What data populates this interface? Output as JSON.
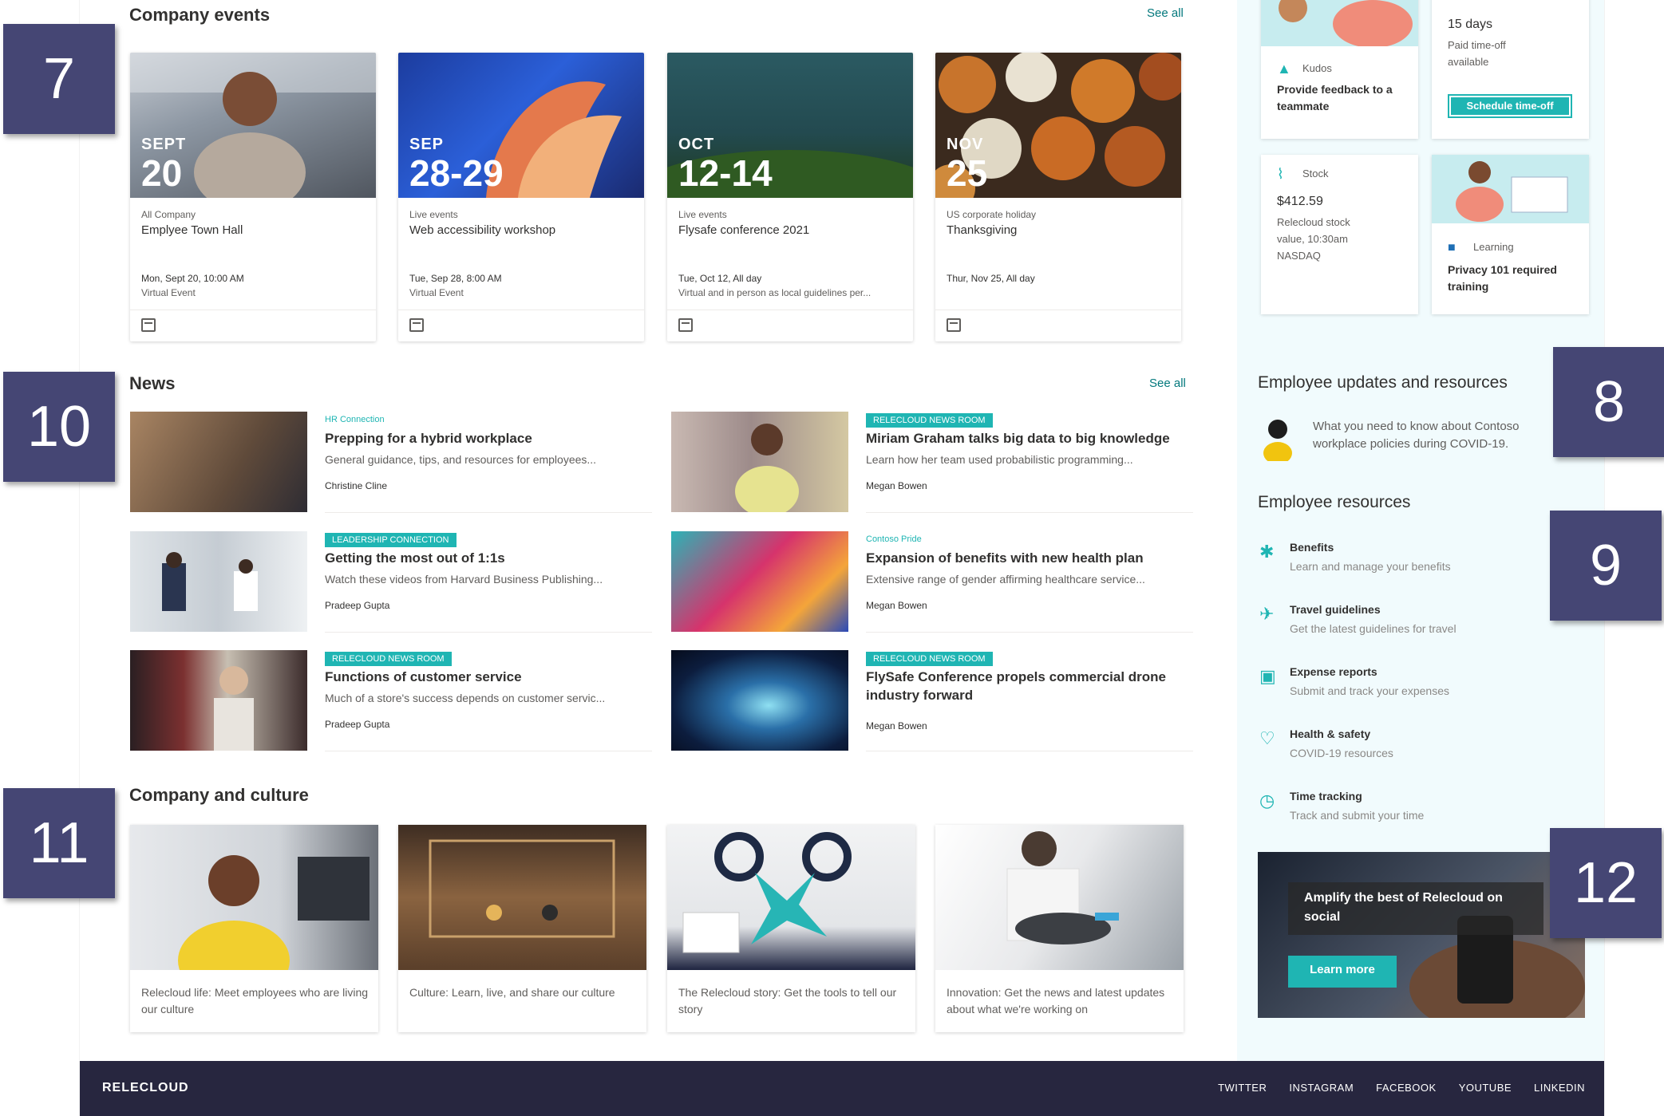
{
  "events": {
    "title": "Company events",
    "see_all": "See all",
    "items": [
      {
        "month": "SEPT",
        "day": "20",
        "category": "All Company",
        "name": "Emplyee Town Hall",
        "date": "Mon, Sept 20, 10:00 AM",
        "location": "Virtual Event"
      },
      {
        "month": "SEP",
        "day": "28-29",
        "category": "Live events",
        "name": "Web accessibility workshop",
        "date": "Tue, Sep 28, 8:00 AM",
        "location": "Virtual Event"
      },
      {
        "month": "OCT",
        "day": "12-14",
        "category": "Live events",
        "name": "Flysafe conference 2021",
        "date": "Tue, Oct 12, All day",
        "location": "Virtual and in person as local guidelines per..."
      },
      {
        "month": "NOV",
        "day": "25",
        "category": "US corporate holiday",
        "name": "Thanksgiving",
        "date": "Thur, Nov 25, All day",
        "location": ""
      }
    ]
  },
  "news": {
    "title": "News",
    "see_all": "See all",
    "items": [
      {
        "tag": "HR Connection",
        "tag_style": "plain",
        "title": "Prepping for a hybrid workplace",
        "desc": "General guidance, tips, and resources for employees...",
        "author": "Christine Cline"
      },
      {
        "tag": "RELECLOUD NEWS ROOM",
        "tag_style": "pill",
        "title": "Miriam Graham talks big data to big knowledge",
        "desc": "Learn how her team used probabilistic programming...",
        "author": "Megan Bowen"
      },
      {
        "tag": "LEADERSHIP CONNECTION",
        "tag_style": "pill",
        "title": "Getting the most out of 1:1s",
        "desc": "Watch these videos from Harvard Business Publishing...",
        "author": "Pradeep Gupta"
      },
      {
        "tag": "Contoso Pride",
        "tag_style": "plain",
        "title": "Expansion of benefits with new health plan",
        "desc": "Extensive range of gender affirming healthcare service...",
        "author": "Megan Bowen"
      },
      {
        "tag": "RELECLOUD NEWS ROOM",
        "tag_style": "pill",
        "title": "Functions of customer service",
        "desc": "Much of a store's success depends on customer servic...",
        "author": "Pradeep Gupta"
      },
      {
        "tag": "RELECLOUD NEWS ROOM",
        "tag_style": "pill",
        "title": "FlySafe Conference propels commercial drone industry forward",
        "desc": "",
        "author": "Megan Bowen"
      }
    ]
  },
  "culture": {
    "title": "Company and culture",
    "items": [
      {
        "caption": "Relecloud life: Meet employees who are living our culture"
      },
      {
        "caption": "Culture: Learn, live, and share our culture"
      },
      {
        "caption": "The Relecloud story: Get the tools to tell our story"
      },
      {
        "caption": "Innovation: Get the news and latest updates about what we're working on"
      }
    ]
  },
  "side": {
    "kudos": {
      "label": "Kudos",
      "text": "Provide feedback to a teammate"
    },
    "timeoff": {
      "days": "15 days",
      "text": "Paid time-off available",
      "button": "Schedule time-off"
    },
    "stock": {
      "label": "Stock",
      "value": "$412.59",
      "text": "Relecloud stock value, 10:30am NASDAQ"
    },
    "learning": {
      "label": "Learning",
      "text": "Privacy 101 required training"
    },
    "updates": {
      "title": "Employee updates and resources",
      "text": "What you need to know about Contoso workplace policies during COVID-19."
    },
    "resources": {
      "title": "Employee resources",
      "items": [
        {
          "icon": "benefits-icon",
          "glyph": "✱",
          "title": "Benefits",
          "desc": "Learn and manage your benefits"
        },
        {
          "icon": "airplane-icon",
          "glyph": "✈",
          "title": "Travel guidelines",
          "desc": "Get the latest guidelines for travel"
        },
        {
          "icon": "money-icon",
          "glyph": "▣",
          "title": "Expense reports",
          "desc": "Submit and track your expenses"
        },
        {
          "icon": "heart-icon",
          "glyph": "♡",
          "title": "Health & safety",
          "desc": "COVID-19 resources"
        },
        {
          "icon": "clock-icon",
          "glyph": "◷",
          "title": "Time tracking",
          "desc": "Track and submit your time"
        }
      ]
    },
    "promo": {
      "text": "Amplify the best of Relecloud on social",
      "button": "Learn more"
    }
  },
  "callouts": [
    "7",
    "8",
    "9",
    "10",
    "11",
    "12"
  ],
  "footer": {
    "brand": "RELECLOUD",
    "links": [
      "TWITTER",
      "INSTAGRAM",
      "FACEBOOK",
      "YOUTUBE",
      "LINKEDIN"
    ]
  },
  "colors": {
    "accent": "#1fb5b3",
    "callout": "#454674",
    "footer": "#27263f",
    "side_bg": "#f1fbfd"
  }
}
